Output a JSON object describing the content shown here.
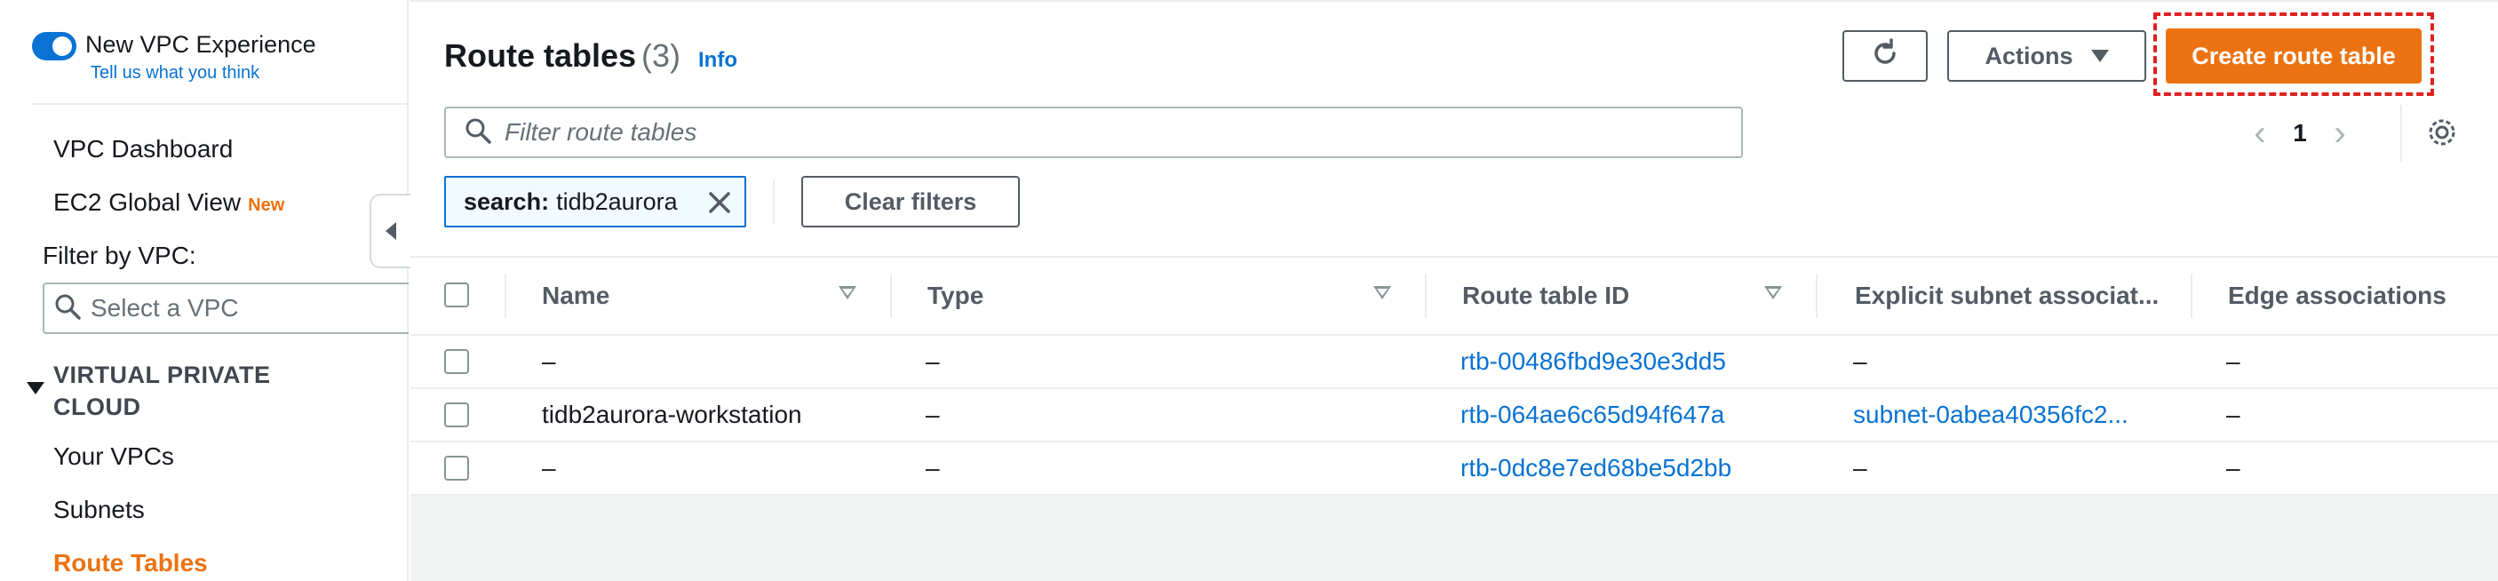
{
  "sidebar": {
    "toggle_title": "New VPC Experience",
    "toggle_link": "Tell us what you think",
    "items": [
      {
        "label": "VPC Dashboard"
      },
      {
        "label": "EC2 Global View",
        "badge": "New"
      }
    ],
    "filter_label": "Filter by VPC:",
    "vpc_select_placeholder": "Select a VPC",
    "section_title": "VIRTUAL PRIVATE CLOUD",
    "section_items": [
      {
        "label": "Your VPCs"
      },
      {
        "label": "Subnets"
      },
      {
        "label": "Route Tables",
        "active": true
      }
    ]
  },
  "header": {
    "title": "Route tables",
    "count": "(3)",
    "info": "Info"
  },
  "toolbar": {
    "refresh_icon": "refresh-icon",
    "actions_label": "Actions",
    "create_label": "Create route table"
  },
  "filter": {
    "placeholder": "Filter route tables",
    "token_key": "search:",
    "token_value": "tidb2aurora",
    "clear_label": "Clear filters"
  },
  "pagination": {
    "current_page": "1"
  },
  "table": {
    "columns": [
      "Name",
      "Type",
      "Route table ID",
      "Explicit subnet associat...",
      "Edge associations"
    ],
    "rows": [
      {
        "name": "–",
        "type": "–",
        "id": "rtb-00486fbd9e30e3dd5",
        "subnet": "–",
        "edge": "–"
      },
      {
        "name": "tidb2aurora-workstation",
        "type": "–",
        "id": "rtb-064ae6c65d94f647a",
        "subnet": "subnet-0abea40356fc2...",
        "edge": "–"
      },
      {
        "name": "–",
        "type": "–",
        "id": "rtb-0dc8e7ed68be5d2bb",
        "subnet": "–",
        "edge": "–"
      }
    ]
  },
  "colors": {
    "accent": "#ec7211",
    "link": "#0972d3",
    "highlight_outline": "#e02020"
  }
}
